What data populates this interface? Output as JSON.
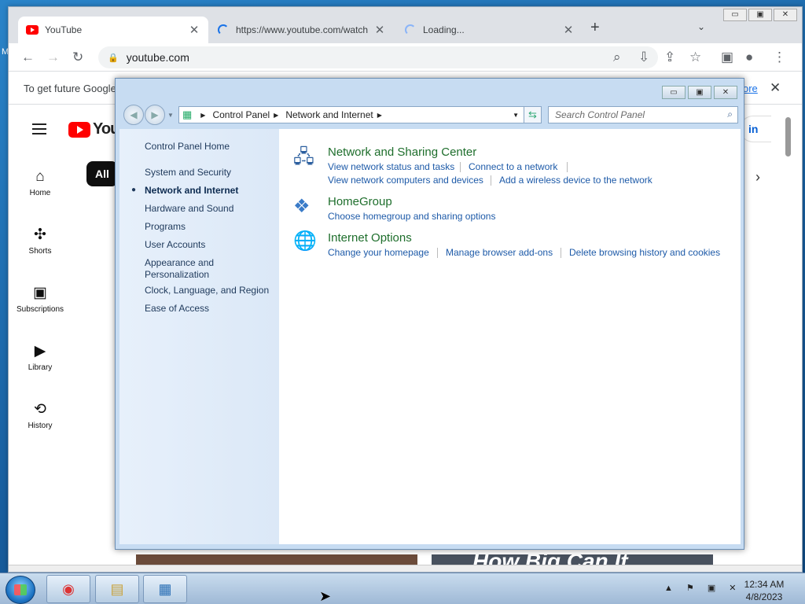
{
  "desktop": {
    "edge_text": "M"
  },
  "browser": {
    "window_buttons": [
      "▭",
      "▣",
      "✕"
    ],
    "tabs": [
      {
        "title": "YouTube",
        "close": "✕"
      },
      {
        "title": "https://www.youtube.com/watch",
        "close": "✕"
      },
      {
        "title": "Loading...",
        "close": "✕"
      }
    ],
    "new_tab": "+",
    "tab_menu": "⌄",
    "address": "youtube.com",
    "icons": {
      "back": "←",
      "forward": "→",
      "reload": "↻",
      "lock": "🔒",
      "zoom": "⌕",
      "install": "⇩",
      "share": "⇪",
      "star": "☆",
      "sidepanel": "▣",
      "profile": "●",
      "menu": "⋮"
    },
    "infobar": {
      "text": "To get future Google",
      "more": "ore",
      "close": "✕"
    }
  },
  "youtube": {
    "logo": "YouT",
    "chip": "All",
    "signin": "in",
    "nav": [
      {
        "label": "Home",
        "icon": "⌂"
      },
      {
        "label": "Shorts",
        "icon": "✣"
      },
      {
        "label": "Subscriptions",
        "icon": "▣"
      },
      {
        "label": "Library",
        "icon": "▶"
      },
      {
        "label": "History",
        "icon": "⟲"
      }
    ],
    "chevron": "›",
    "thumb2_text": "How Big Can It"
  },
  "control_panel": {
    "window_buttons": [
      "▭",
      "▣",
      "✕"
    ],
    "breadcrumb": [
      "Control Panel",
      "Network and Internet"
    ],
    "search_placeholder": "Search Control Panel",
    "left_nav": [
      "Control Panel Home",
      "System and Security",
      "Network and Internet",
      "Hardware and Sound",
      "Programs",
      "User Accounts",
      "Appearance and Personalization",
      "Clock, Language, and Region",
      "Ease of Access"
    ],
    "current_item": "Network and Internet",
    "categories": [
      {
        "title": "Network and Sharing Center",
        "icon": "🖧",
        "links": [
          "View network status and tasks",
          "Connect to a network",
          "View network computers and devices",
          "Add a wireless device to the network"
        ]
      },
      {
        "title": "HomeGroup",
        "icon": "❖",
        "links": [
          "Choose homegroup and sharing options"
        ]
      },
      {
        "title": "Internet Options",
        "icon": "🌐",
        "links": [
          "Change your homepage",
          "Manage browser add-ons",
          "Delete browsing history and cookies"
        ]
      }
    ]
  },
  "taskbar": {
    "apps": [
      {
        "name": "Google Chrome",
        "icon": "◉"
      },
      {
        "name": "Windows Explorer",
        "icon": "▤"
      },
      {
        "name": "Control Panel",
        "icon": "▦"
      }
    ],
    "tray": "▲ ⚑ ▣ ✕",
    "time": "12:34 AM",
    "date": "4/8/2023"
  }
}
